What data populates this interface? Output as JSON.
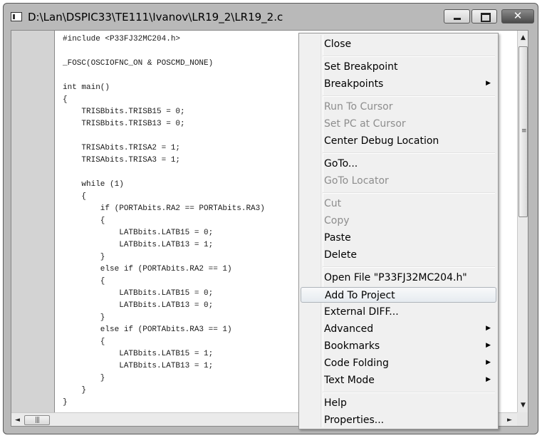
{
  "window": {
    "title": "D:\\Lan\\DSPIC33\\TE111\\Ivanov\\LR19_2\\LR19_2.c",
    "icon": "document-window-icon",
    "minimize_icon": "minimize-icon",
    "maximize_icon": "maximize-icon",
    "close_glyph": "✕"
  },
  "editor": {
    "code": "#include <P33FJ32MC204.h>\n\n_FOSC(OSCIOFNC_ON & POSCMD_NONE)\n\nint main()\n{\n    TRISBbits.TRISB15 = 0;\n    TRISBbits.TRISB13 = 0;\n\n    TRISAbits.TRISA2 = 1;\n    TRISAbits.TRISA3 = 1;\n\n    while (1)\n    {\n        if (PORTAbits.RA2 == PORTAbits.RA3)\n        {\n            LATBbits.LATB15 = 0;\n            LATBbits.LATB13 = 1;\n        }\n        else if (PORTAbits.RA2 == 1)\n        {\n            LATBbits.LATB15 = 0;\n            LATBbits.LATB13 = 0;\n        }\n        else if (PORTAbits.RA3 == 1)\n        {\n            LATBbits.LATB15 = 1;\n            LATBbits.LATB13 = 1;\n        }\n    }\n}"
  },
  "scroll": {
    "up": "▲",
    "down": "▼",
    "left": "◄",
    "right": "►",
    "grip_v": "≡",
    "grip_h": "|||"
  },
  "context_menu": {
    "items": [
      {
        "label": "Close",
        "enabled": true
      },
      {
        "label": "Set Breakpoint",
        "enabled": true
      },
      {
        "label": "Breakpoints",
        "enabled": true,
        "submenu": true
      },
      {
        "label": "Run To Cursor",
        "enabled": false
      },
      {
        "label": "Set PC at Cursor",
        "enabled": false
      },
      {
        "label": "Center Debug Location",
        "enabled": true
      },
      {
        "label": "GoTo...",
        "enabled": true
      },
      {
        "label": "GoTo Locator",
        "enabled": false
      },
      {
        "label": "Cut",
        "enabled": false
      },
      {
        "label": "Copy",
        "enabled": false
      },
      {
        "label": "Paste",
        "enabled": true
      },
      {
        "label": "Delete",
        "enabled": true
      },
      {
        "label": "Open File \"P33FJ32MC204.h\"",
        "enabled": true
      },
      {
        "label": "Add To Project",
        "enabled": true,
        "highlighted": true
      },
      {
        "label": "External DIFF...",
        "enabled": true
      },
      {
        "label": "Advanced",
        "enabled": true,
        "submenu": true
      },
      {
        "label": "Bookmarks",
        "enabled": true,
        "submenu": true
      },
      {
        "label": "Code Folding",
        "enabled": true,
        "submenu": true
      },
      {
        "label": "Text Mode",
        "enabled": true,
        "submenu": true
      },
      {
        "label": "Help",
        "enabled": true
      },
      {
        "label": "Properties...",
        "enabled": true
      }
    ],
    "submenu_arrow": "▶"
  }
}
